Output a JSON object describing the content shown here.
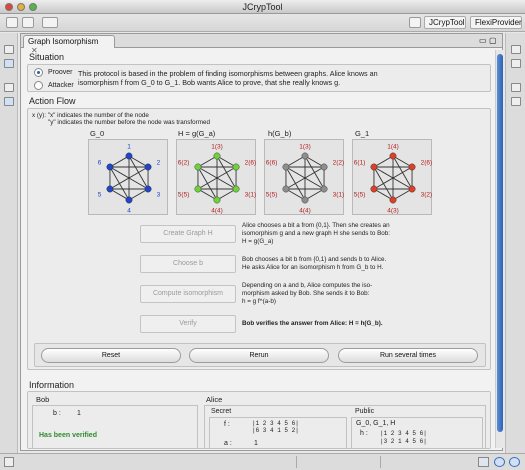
{
  "window": {
    "title": "JCrypTool"
  },
  "perspectives": {
    "jcryptool": "JCrypTool",
    "flexiprovider": "FlexiProvider"
  },
  "tab": {
    "label": "Graph Isomorphism"
  },
  "situation": {
    "title": "Situation",
    "proover": "Proover",
    "attacker": "Attacker",
    "selected": "Proover",
    "text": "This protocol is based in the problem of finding isomorphisms between graphs. Alice knows an isomorphism f from G_0 to G_1. Bob wants Alice to prove, that she really knows g."
  },
  "action_flow": {
    "title": "Action Flow",
    "note_line1": "x (y): \"x\" indicates the number of the node",
    "note_line2": "\"y\" indicates the number before the node was transformed",
    "graphs": [
      {
        "title": "G_0",
        "labels": [
          "1",
          "2",
          "3",
          "4",
          "5",
          "6"
        ],
        "color": "#2346c8"
      },
      {
        "title": "H = g(G_a)",
        "labels": [
          "1(3)",
          "2(6)",
          "3(1)",
          "4(4)",
          "5(5)",
          "6(2)"
        ],
        "color": "#6fd23a"
      },
      {
        "title": "h(G_b)",
        "labels": [
          "1(3)",
          "2(2)",
          "3(1)",
          "4(4)",
          "5(5)",
          "6(6)"
        ],
        "color": "#8e8e8e"
      },
      {
        "title": "G_1",
        "labels": [
          "1(4)",
          "2(6)",
          "3(2)",
          "4(3)",
          "5(5)",
          "6(1)"
        ],
        "color": "#d9412a"
      }
    ],
    "steps": [
      {
        "button": "Create Graph H",
        "text": [
          "Alice chooses a bit a from {0,1}. Then she creates an",
          "isomorphism g and a new graph H she sends to Bob:",
          "H = g(G_a)"
        ]
      },
      {
        "button": "Choose b",
        "text": [
          "Bob chooses a bit b from {0,1} and sends b to Alice.",
          "He asks Alice for an isomorphism h from G_b to H."
        ]
      },
      {
        "button": "Compute isomorphism",
        "text": [
          "Depending on a and b, Alice computes the iso-",
          "morphism asked by Bob. She sends it to Bob:",
          "h = g f^(a-b)"
        ]
      },
      {
        "button": "Verify",
        "text": [
          "Bob verifies the answer from Alice: H = h(G_b)."
        ]
      }
    ],
    "reset": "Reset",
    "rerun": "Rerun",
    "run_several": "Run several times"
  },
  "information": {
    "title": "Information",
    "bob": {
      "title": "Bob",
      "b_label": "b :",
      "b_value": "1",
      "status": "Has been verified"
    },
    "alice": {
      "title": "Alice",
      "secret": {
        "title": "Secret",
        "f_label": "f :",
        "f_row1": "|1 2 3 4 5 6|",
        "f_row2": "|6 3 4 1 5 2|",
        "a_label": "a :",
        "a_value": "1"
      },
      "public": {
        "title": "Public",
        "graphs": "G_0, G_1, H",
        "h_label": "h :",
        "h_row1": "|1 2 3 4 5 6|",
        "h_row2": "|3 2 1 4 5 6|"
      }
    }
  },
  "colors": {
    "accent": "#2d63b4",
    "verified": "#2e8b2e",
    "node_label_red": "#b22222",
    "node_label_blue": "#1f3fbf"
  }
}
